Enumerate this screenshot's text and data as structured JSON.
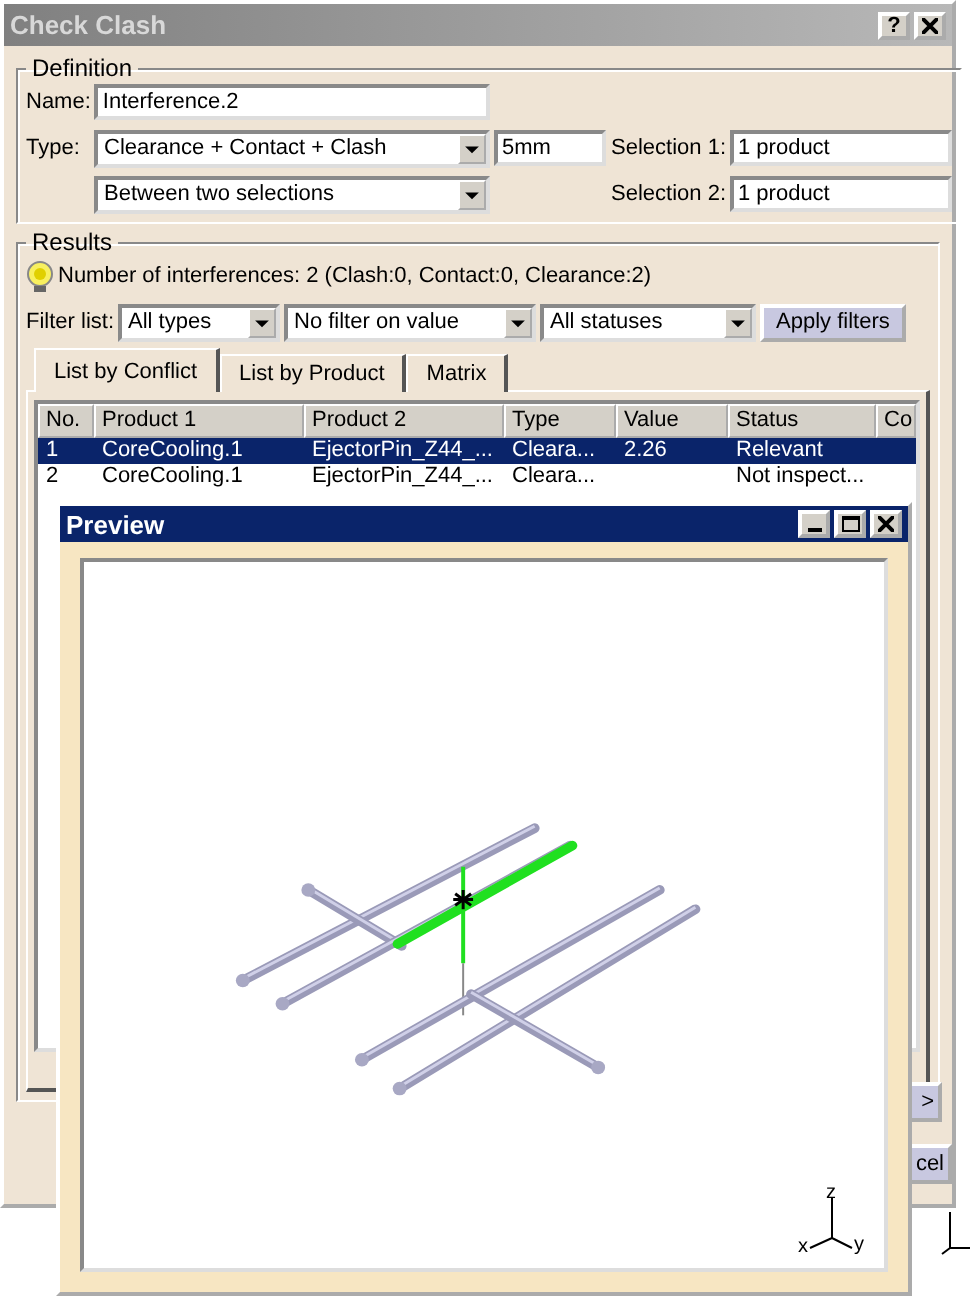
{
  "dialog": {
    "title": "Check Clash",
    "help": "?",
    "definition": {
      "legend": "Definition",
      "name_label": "Name:",
      "name": "Interference.2",
      "type_label": "Type:",
      "type": "Clearance + Contact + Clash",
      "distance": "5mm",
      "mode": "Between two selections",
      "selections": [
        {
          "label": "Selection 1:",
          "value": "1 product"
        },
        {
          "label": "Selection 2:",
          "value": "1 product"
        }
      ]
    },
    "results": {
      "legend": "Results",
      "summary": "Number of interferences: 2 (Clash:0, Contact:0, Clearance:2)",
      "filter_label": "Filter list:",
      "filters": [
        "All types",
        "No filter on value",
        "All statuses"
      ],
      "apply": "Apply filters",
      "tabs": [
        {
          "label": "List by Conflict",
          "selected": true
        },
        {
          "label": "List by Product",
          "selected": false
        },
        {
          "label": "Matrix",
          "selected": false
        }
      ],
      "table": {
        "columns": [
          "No.",
          "Product 1",
          "Product 2",
          "Type",
          "Value",
          "Status",
          "Co"
        ],
        "rows": [
          {
            "cells": [
              "1",
              "CoreCooling.1",
              "EjectorPin_Z44_...",
              "Cleara...",
              "2.26",
              "Relevant"
            ],
            "selected": true
          },
          {
            "cells": [
              "2",
              "CoreCooling.1",
              "EjectorPin_Z44_...",
              "Cleara...",
              "",
              "Not inspect..."
            ],
            "selected": false
          }
        ]
      }
    },
    "buttons": [
      ">",
      "cel"
    ]
  },
  "preview": {
    "title": "Preview",
    "triad": [
      "z",
      "x",
      "y"
    ]
  }
}
